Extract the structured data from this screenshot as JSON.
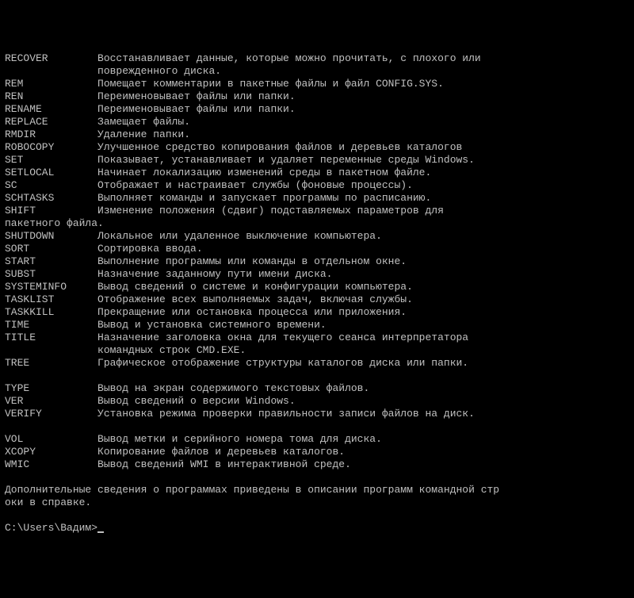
{
  "commands": [
    {
      "name": "RECOVER",
      "desc": "Восстанавливает данные, которые можно прочитать, с плохого или\n               поврежденного диска."
    },
    {
      "name": "REM",
      "desc": "Помещает комментарии в пакетные файлы и файл CONFIG.SYS."
    },
    {
      "name": "REN",
      "desc": "Переименовывает файлы или папки."
    },
    {
      "name": "RENAME",
      "desc": "Переименовывает файлы или папки."
    },
    {
      "name": "REPLACE",
      "desc": "Замещает файлы."
    },
    {
      "name": "RMDIR",
      "desc": "Удаление папки."
    },
    {
      "name": "ROBOCOPY",
      "desc": "Улучшенное средство копирования файлов и деревьев каталогов"
    },
    {
      "name": "SET",
      "desc": "Показывает, устанавливает и удаляет переменные среды Windows."
    },
    {
      "name": "SETLOCAL",
      "desc": "Начинает локализацию изменений среды в пакетном файле."
    },
    {
      "name": "SC",
      "desc": "Отображает и настраивает службы (фоновые процессы)."
    },
    {
      "name": "SCHTASKS",
      "desc": "Выполняет команды и запускает программы по расписанию."
    },
    {
      "name": "SHIFT",
      "desc": "Изменение положения (сдвиг) подставляемых параметров для\nпакетного файла."
    },
    {
      "name": "SHUTDOWN",
      "desc": "Локальное или удаленное выключение компьютера."
    },
    {
      "name": "SORT",
      "desc": "Сортировка ввода."
    },
    {
      "name": "START",
      "desc": "Выполнение программы или команды в отдельном окне."
    },
    {
      "name": "SUBST",
      "desc": "Назначение заданному пути имени диска."
    },
    {
      "name": "SYSTEMINFO",
      "desc": "Вывод сведений о системе и конфигурации компьютера."
    },
    {
      "name": "TASKLIST",
      "desc": "Отображение всех выполняемых задач, включая службы."
    },
    {
      "name": "TASKKILL",
      "desc": "Прекращение или остановка процесса или приложения."
    },
    {
      "name": "TIME",
      "desc": "Вывод и установка системного времени."
    },
    {
      "name": "TITLE",
      "desc": "Назначение заголовка окна для текущего сеанса интерпретатора\n               командных строк CMD.EXE."
    },
    {
      "name": "TREE",
      "desc": "Графическое отображение структуры каталогов диска или папки."
    },
    {
      "name": "",
      "desc": ""
    },
    {
      "name": "TYPE",
      "desc": "Вывод на экран содержимого текстовых файлов."
    },
    {
      "name": "VER",
      "desc": "Вывод сведений о версии Windows."
    },
    {
      "name": "VERIFY",
      "desc": "Установка режима проверки правильности записи файлов на диск."
    },
    {
      "name": "",
      "desc": ""
    },
    {
      "name": "VOL",
      "desc": "Вывод метки и серийного номера тома для диска."
    },
    {
      "name": "XCOPY",
      "desc": "Копирование файлов и деревьев каталогов."
    },
    {
      "name": "WMIC",
      "desc": "Вывод сведений WMI в интерактивной среде."
    }
  ],
  "footer": "Дополнительные сведения о программах приведены в описании программ командной стр\nоки в справке.",
  "prompt": "C:\\Users\\Вадим>"
}
